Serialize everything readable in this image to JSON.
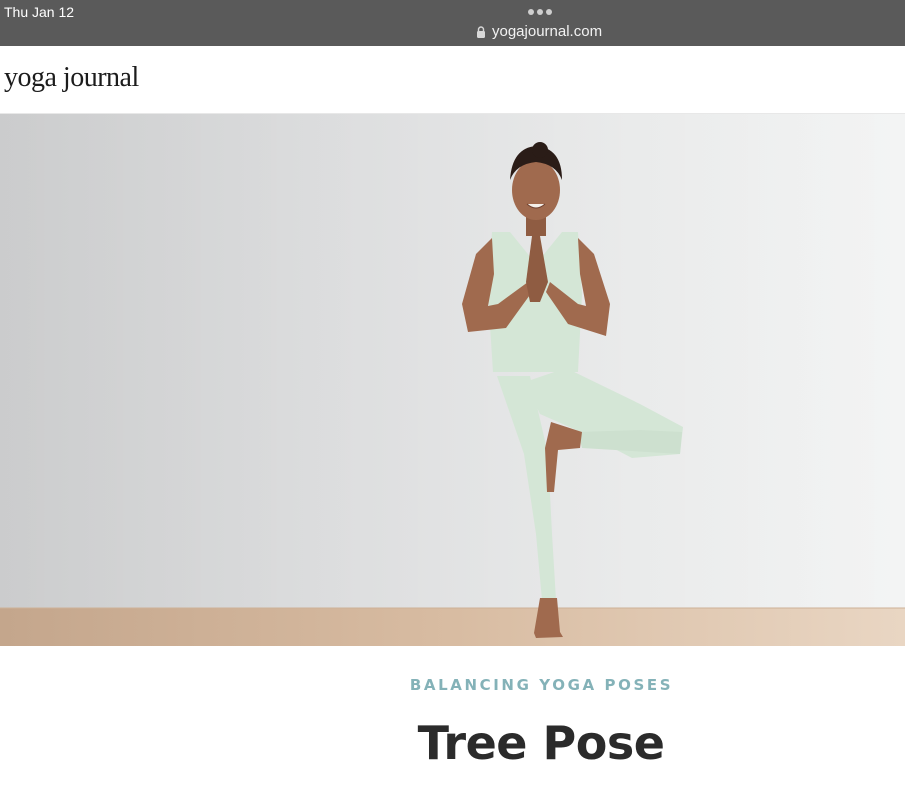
{
  "status_bar": {
    "time": "Thu Jan 12",
    "url": "yogajournal.com",
    "icons": [
      "lock-icon",
      "more-dots-icon"
    ]
  },
  "header": {
    "logo_text": "yoga journal"
  },
  "hero": {
    "image_alt": "Woman in mint green outfit doing tree pose"
  },
  "article": {
    "category": "BALANCING YOGA POSES",
    "title": "Tree Pose"
  },
  "colors": {
    "status_bar_bg": "#5a5a5a",
    "category_accent": "#84b2b8",
    "title_text": "#2b2b2b",
    "outfit": "#d4e6d6"
  }
}
